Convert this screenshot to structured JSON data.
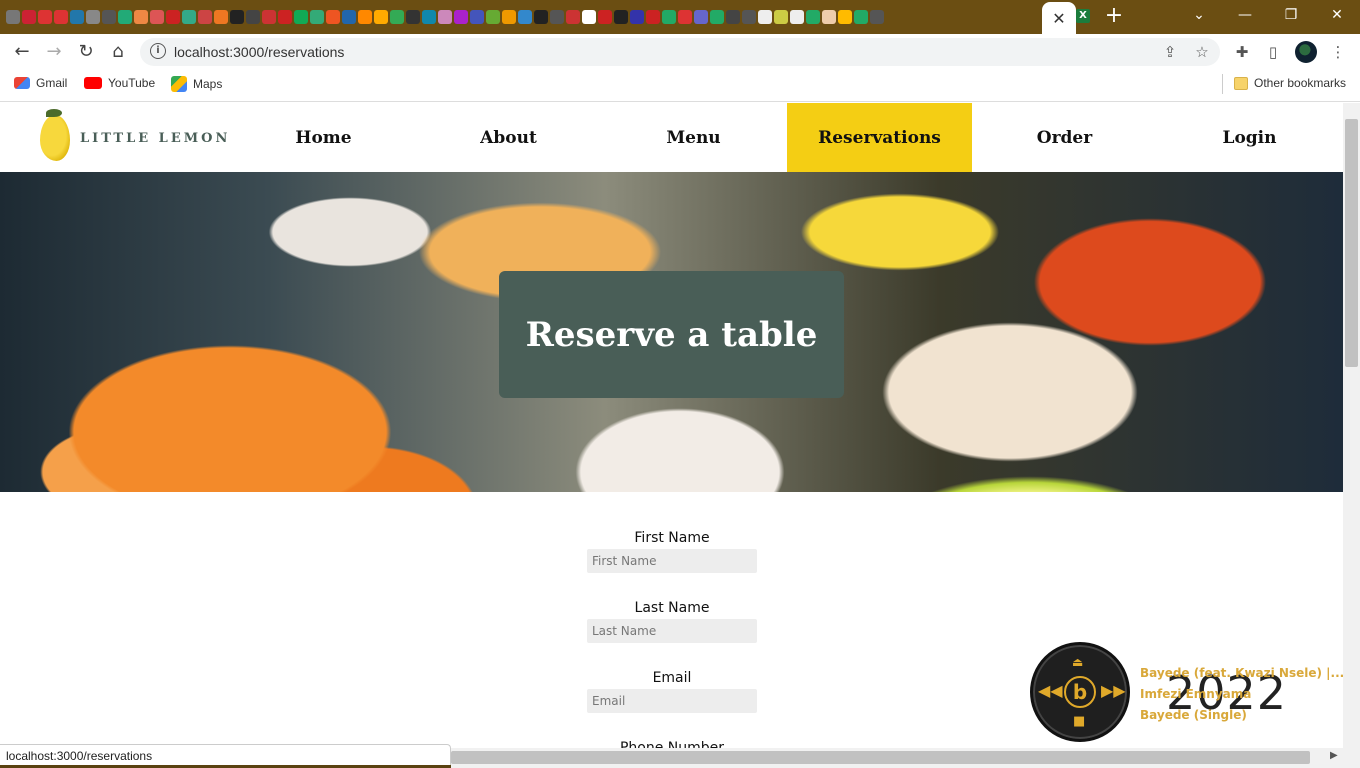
{
  "browser": {
    "active_tab_close": "✕",
    "new_tab": "+",
    "window_controls": {
      "tab_search": "⌄",
      "minimize": "—",
      "restore": "❐",
      "close": "✕"
    },
    "url": "localhost:3000/reservations",
    "bookmarks": [
      {
        "label": "Gmail",
        "color": "#ea4335"
      },
      {
        "label": "YouTube",
        "color": "#ff0000"
      },
      {
        "label": "Maps",
        "color": "#34a853"
      }
    ],
    "other_bookmarks": "Other bookmarks",
    "status_url": "localhost:3000/reservations",
    "tab_icon_colors": [
      "#777",
      "#c23",
      "#d33",
      "#d33",
      "#27a",
      "#888",
      "#555",
      "#2a7",
      "#e84",
      "#d55",
      "#c22",
      "#3a8",
      "#c44",
      "#e72",
      "#222",
      "#444",
      "#c33",
      "#c22",
      "#1a5",
      "#3a7",
      "#e52",
      "#26a",
      "#f80",
      "#fa0",
      "#3a5",
      "#333",
      "#18a",
      "#c8b",
      "#a2c",
      "#45b",
      "#6a3",
      "#e90",
      "#38c",
      "#222",
      "#555",
      "#c33",
      "#fff",
      "#c22",
      "#222",
      "#33a",
      "#c22",
      "#2a6",
      "#d33",
      "#66c",
      "#2a6",
      "#444",
      "#555",
      "#eee",
      "#cc4",
      "#eee",
      "#2a6",
      "#eca",
      "#fb0",
      "#2a6",
      "#555"
    ]
  },
  "site": {
    "logo_text": "LITTLE LEMON",
    "nav": [
      {
        "label": "Home",
        "active": false
      },
      {
        "label": "About",
        "active": false
      },
      {
        "label": "Menu",
        "active": false
      },
      {
        "label": "Reservations",
        "active": true
      },
      {
        "label": "Order",
        "active": false
      },
      {
        "label": "Login",
        "active": false
      }
    ],
    "accent_color": "#f4ce14",
    "primary_color": "#495e57",
    "hero_title": "Reserve a table",
    "form": {
      "first_name": {
        "label": "First Name",
        "placeholder": "First Name",
        "value": ""
      },
      "last_name": {
        "label": "Last Name",
        "placeholder": "Last Name",
        "value": ""
      },
      "email": {
        "label": "Email",
        "placeholder": "Email",
        "value": ""
      },
      "phone": {
        "label": "Phone Number"
      }
    }
  },
  "media_widget": {
    "track_title": "Bayede (feat. Kwazi Nsele) |...",
    "artist": " Imfezi Emnyama",
    "album": "Bayede (Single)",
    "year": "2022",
    "logo_letter": "b"
  }
}
